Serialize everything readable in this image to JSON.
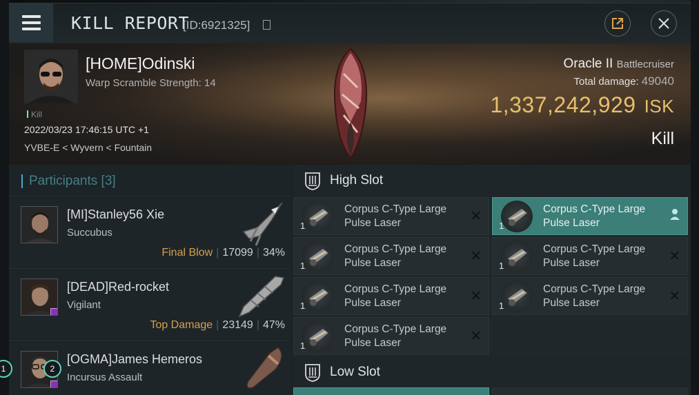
{
  "window": {
    "title": "KILL REPORT",
    "id_label": "[ID:6921325]"
  },
  "victim": {
    "name": "[HOME]Odinski",
    "warp": "Warp Scramble Strength: 14",
    "kill_tag": "Kill",
    "timestamp": "2022/03/23 17:46:15 UTC +1",
    "location": "YVBE-E < Wyvern < Fountain"
  },
  "summary": {
    "ship": "Oracle II",
    "ship_class": "Battlecruiser",
    "total_damage_label": "Total damage:",
    "total_damage": "49040",
    "isk_value": "1,337,242,929",
    "isk_unit": "ISK",
    "kill_type": "Kill"
  },
  "participants": {
    "label": "Participants [3]",
    "items": [
      {
        "name": "[MI]Stanley56 Xie",
        "ship": "Succubus",
        "tag": "Final Blow",
        "damage": "17099",
        "percent": "34%"
      },
      {
        "name": "[DEAD]Red-rocket",
        "ship": "Vigilant",
        "tag": "Top Damage",
        "damage": "23149",
        "percent": "47%"
      },
      {
        "name": "[OGMA]James Hemeros",
        "ship": "Incursus Assault",
        "tag": "",
        "damage": "",
        "percent": ""
      }
    ]
  },
  "high_slot": {
    "label": "High Slot",
    "modules": [
      {
        "qty": "1",
        "name": "Corpus C-Type Large Pulse Laser",
        "state": "destroyed"
      },
      {
        "qty": "1",
        "name": "Corpus C-Type Large Pulse Laser",
        "state": "selected"
      },
      {
        "qty": "1",
        "name": "Corpus C-Type Large Pulse Laser",
        "state": "destroyed"
      },
      {
        "qty": "1",
        "name": "Corpus C-Type Large Pulse Laser",
        "state": "destroyed"
      },
      {
        "qty": "1",
        "name": "Corpus C-Type Large Pulse Laser",
        "state": "destroyed"
      },
      {
        "qty": "1",
        "name": "Corpus C-Type Large Pulse Laser",
        "state": "destroyed"
      },
      {
        "qty": "1",
        "name": "Corpus C-Type Large Pulse Laser",
        "state": "destroyed"
      }
    ]
  },
  "low_slot": {
    "label": "Low Slot"
  },
  "markers": [
    "1",
    "2"
  ],
  "colors": {
    "accent": "#5cd3c0",
    "isk": "#e8bf6b",
    "tag": "#d5a04e",
    "selected": "#3c7e78"
  }
}
